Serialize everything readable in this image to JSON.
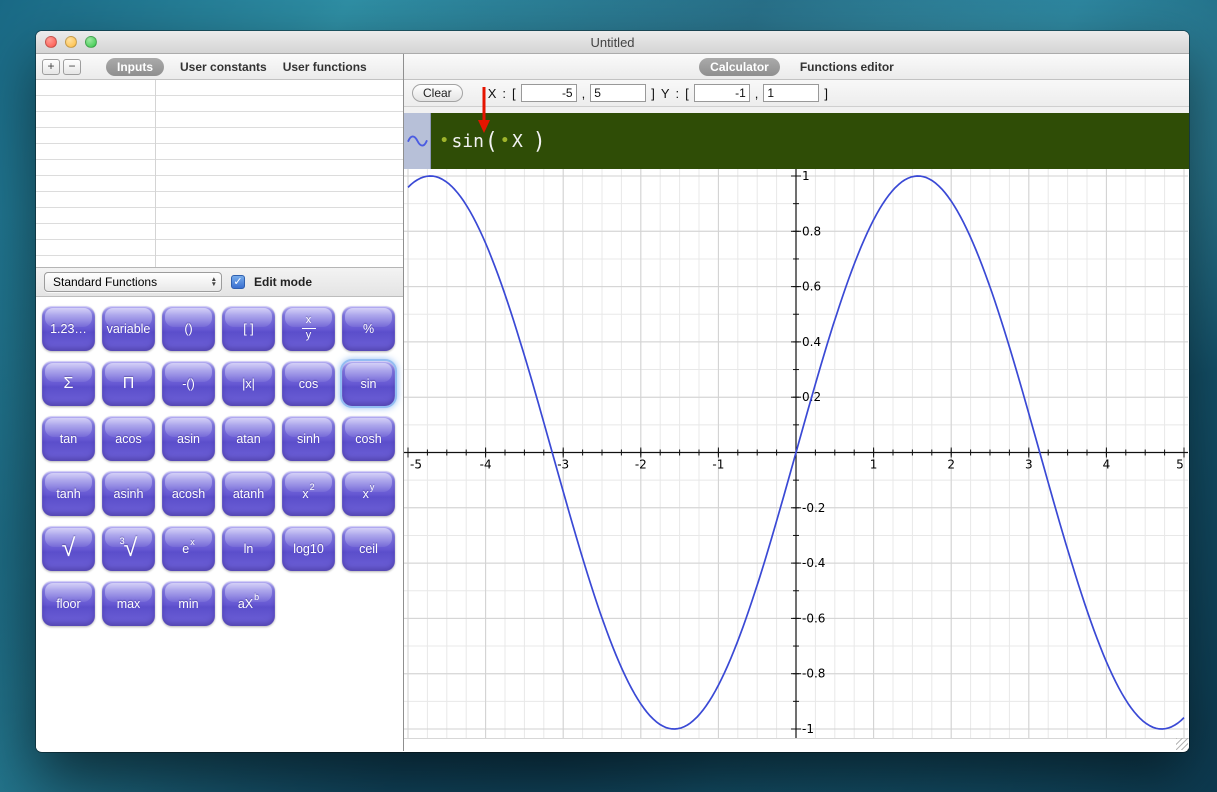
{
  "window": {
    "title": "Untitled"
  },
  "left_panel": {
    "toolbar": {
      "add_label": "+",
      "remove_label": "−",
      "tabs": [
        {
          "label": "Inputs",
          "selected": true
        },
        {
          "label": "User constants",
          "selected": false
        },
        {
          "label": "User functions",
          "selected": false
        }
      ]
    },
    "table": {
      "rows": 11,
      "columns": 2
    },
    "controls": {
      "category_dropdown": "Standard Functions",
      "edit_mode_label": "Edit mode",
      "edit_mode_checked": true,
      "checkmark": "✓"
    },
    "keypad": {
      "buttons": [
        {
          "name": "number",
          "label": "1.23…"
        },
        {
          "name": "variable",
          "label": "variable"
        },
        {
          "name": "parentheses",
          "label": "()"
        },
        {
          "name": "brackets",
          "label": "[ ]"
        },
        {
          "name": "fraction",
          "top": "x",
          "bottom": "y"
        },
        {
          "name": "percent",
          "label": "%"
        },
        {
          "name": "sum",
          "label": "Σ"
        },
        {
          "name": "product",
          "label": "Π"
        },
        {
          "name": "negate",
          "label": "-()"
        },
        {
          "name": "abs",
          "label": "|x|"
        },
        {
          "name": "cos",
          "label": "cos"
        },
        {
          "name": "sin",
          "label": "sin",
          "selected": true
        },
        {
          "name": "tan",
          "label": "tan"
        },
        {
          "name": "acos",
          "label": "acos"
        },
        {
          "name": "asin",
          "label": "asin"
        },
        {
          "name": "atan",
          "label": "atan"
        },
        {
          "name": "sinh",
          "label": "sinh"
        },
        {
          "name": "cosh",
          "label": "cosh"
        },
        {
          "name": "tanh",
          "label": "tanh"
        },
        {
          "name": "asinh",
          "label": "asinh"
        },
        {
          "name": "acosh",
          "label": "acosh"
        },
        {
          "name": "atanh",
          "label": "atanh"
        },
        {
          "name": "x-squared",
          "label": "x",
          "sup": "2"
        },
        {
          "name": "x-power-y",
          "label": "x",
          "sup": "y"
        },
        {
          "name": "sqrt",
          "label": "√"
        },
        {
          "name": "cbrt",
          "label": "√",
          "pre": "3"
        },
        {
          "name": "e-power-x",
          "label": "e",
          "sup": "x"
        },
        {
          "name": "ln",
          "label": "ln"
        },
        {
          "name": "log10",
          "label": "log10"
        },
        {
          "name": "ceil",
          "label": "ceil"
        },
        {
          "name": "floor",
          "label": "floor"
        },
        {
          "name": "max",
          "label": "max"
        },
        {
          "name": "min",
          "label": "min"
        },
        {
          "name": "ax-power-b",
          "label": "aX",
          "sup": "b"
        }
      ]
    }
  },
  "right_panel": {
    "tabs": [
      {
        "label": "Calculator",
        "selected": true
      },
      {
        "label": "Functions editor",
        "selected": false
      }
    ],
    "range_bar": {
      "clear_label": "Clear",
      "x_label": "X",
      "y_label": "Y",
      "colon": ":",
      "open_bracket": "[",
      "close_bracket": "]",
      "comma": ",",
      "x_min": "-5",
      "x_max": "5",
      "y_min": "-1",
      "y_max": "1"
    },
    "formula_bar": {
      "tokens": [
        "•",
        "sin",
        "(",
        "•",
        "X",
        ")"
      ]
    },
    "chart_data": {
      "type": "line",
      "title": "",
      "function_name": "sin",
      "series": [
        {
          "name": "sin(X)",
          "expr": "sin"
        }
      ],
      "x_range": [
        -5,
        5
      ],
      "y_range": [
        -1,
        1
      ],
      "x_major_step": 1,
      "x_minor_step": 0.25,
      "y_major_step": 0.2,
      "y_minor_step": 0.1,
      "x_tick_labels": [
        "-5",
        "-4",
        "-3",
        "-2",
        "-1",
        "1",
        "2",
        "3",
        "4",
        "5"
      ],
      "y_tick_labels": [
        "1",
        "0.8",
        "0.6",
        "0.4",
        "0.2",
        "-0.2",
        "-0.4",
        "-0.6",
        "-0.8",
        "-1"
      ],
      "grid": "on",
      "line_color": "#3a49d5",
      "axis_color": "#111111"
    }
  }
}
